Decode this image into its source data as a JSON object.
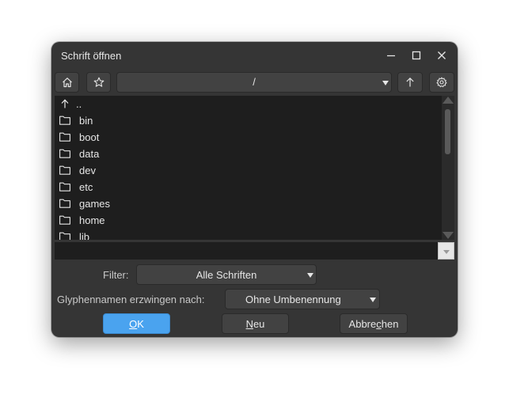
{
  "window": {
    "title": "Schrift öffnen",
    "controls": [
      "minimize-icon",
      "maximize-icon",
      "close-icon"
    ]
  },
  "toolbar": {
    "home_icon": "home-icon",
    "bookmark_icon": "star-icon",
    "path": "/",
    "parent_icon": "arrow-up-icon",
    "settings_icon": "gear-icon"
  },
  "files": [
    {
      "name": "..",
      "icon": "arrow-up-icon"
    },
    {
      "name": "bin",
      "icon": "folder-icon"
    },
    {
      "name": "boot",
      "icon": "folder-icon"
    },
    {
      "name": "data",
      "icon": "folder-icon"
    },
    {
      "name": "dev",
      "icon": "folder-icon"
    },
    {
      "name": "etc",
      "icon": "folder-icon"
    },
    {
      "name": "games",
      "icon": "folder-icon"
    },
    {
      "name": "home",
      "icon": "folder-icon"
    },
    {
      "name": "lib",
      "icon": "folder-icon"
    }
  ],
  "filename_input": {
    "value": ""
  },
  "filter": {
    "label": "Filter:",
    "value": "Alle Schriften"
  },
  "glyph_names": {
    "label": "Glyphennamen erzwingen nach:",
    "value": "Ohne Umbenennung"
  },
  "buttons": {
    "ok": {
      "pre": "",
      "mnemonic": "O",
      "post": "K"
    },
    "new": {
      "pre": "",
      "mnemonic": "N",
      "post": "eu"
    },
    "cancel": {
      "pre": "Abbre",
      "mnemonic": "c",
      "post": "hen"
    }
  },
  "colors": {
    "dialog_bg": "#353535",
    "list_bg": "#1e1e1e",
    "accent": "#4aa3ef",
    "text": "#e6e6e6"
  }
}
